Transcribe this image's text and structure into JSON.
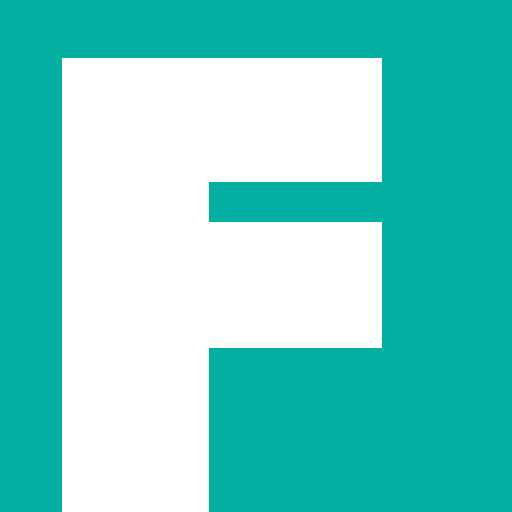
{
  "logo": {
    "letter": "F",
    "icon": "letter-f-logo-icon",
    "colors": {
      "background": "#02AFA0",
      "glyph": "#FFFFFF"
    }
  }
}
